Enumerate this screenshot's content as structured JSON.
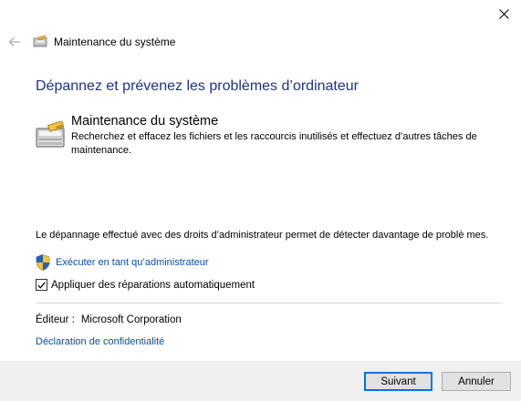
{
  "nav": {
    "title": "Maintenance du système"
  },
  "main": {
    "heading": "Dépannez et prévenez les problèmes d’ordinateur",
    "item": {
      "title": "Maintenance du système",
      "description": "Recherchez et effacez les fichiers et les raccourcis inutilisés et effectuez d’autres tâches de maintenance."
    },
    "admin_note": "Le dépannage effectué avec des droits d’administrateur permet de détecter davantage de problè mes.",
    "run_as_admin_label": "Exécuter en tant qu’administrateur",
    "auto_repair": {
      "label": "Appliquer des réparations automatiquement",
      "checked": true
    },
    "publisher_label": "Éditeur :",
    "publisher_value": "Microsoft Corporation",
    "privacy_link": "Déclaration de confidentialité"
  },
  "footer": {
    "next_label": "Suivant",
    "cancel_label": "Annuler"
  },
  "icons": {
    "close": "close-icon",
    "back": "back-arrow-icon",
    "maintenance": "system-maintenance-icon",
    "shield": "uac-shield-icon",
    "check": "checkmark-icon"
  },
  "colors": {
    "heading": "#1e3287",
    "link": "#0a4fb0",
    "footer_bg": "#f0f0f0",
    "default_button_border": "#0078d7"
  }
}
